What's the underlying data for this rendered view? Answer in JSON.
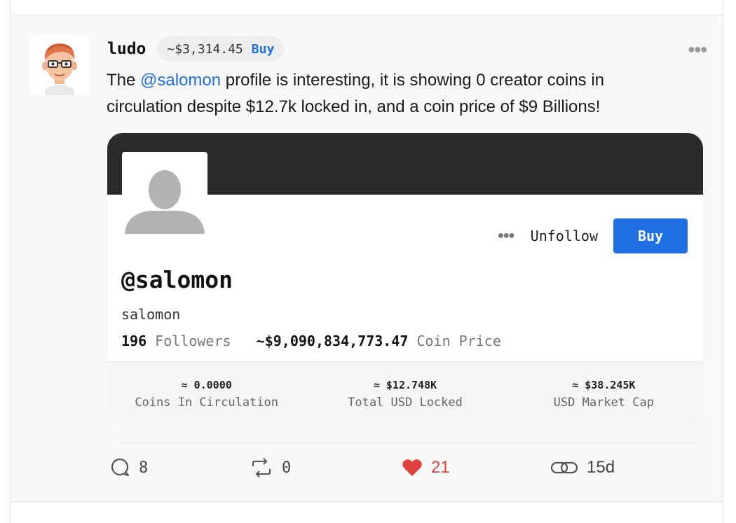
{
  "post": {
    "author": "ludo",
    "author_price": "~$3,314.45",
    "author_buy": "Buy",
    "more_icon": "more-horizontal-icon",
    "text_before": "The ",
    "mention": "@salomon",
    "text_after": " profile is interesting, it is showing 0 creator coins in circulation despite $12.7k locked in, and a coin price of $9 Billions!"
  },
  "profile_card": {
    "actions_icon": "more-horizontal-icon",
    "unfollow_label": "Unfollow",
    "buy_label": "Buy",
    "handle": "@salomon",
    "name": "salomon",
    "followers_count": "196",
    "followers_label": "Followers",
    "coin_price_value": "~$9,090,834,773.47",
    "coin_price_label": "Coin Price",
    "metrics": [
      {
        "value": "≈ 0.0000",
        "label": "Coins In Circulation"
      },
      {
        "value": "≈ $12.748K",
        "label": "Total USD Locked"
      },
      {
        "value": "≈ $38.245K",
        "label": "USD Market Cap"
      }
    ]
  },
  "footer": {
    "comments": "8",
    "reclouts": "0",
    "likes": "21",
    "time": "15d",
    "colors": {
      "like": "#e0413c",
      "accent": "#1f6fe5"
    }
  }
}
